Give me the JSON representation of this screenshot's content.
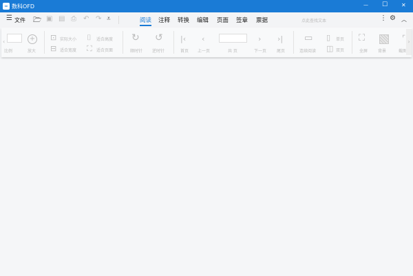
{
  "app": {
    "title": "数科OFD",
    "accent": "#1a7bd6"
  },
  "window_controls": {
    "minimize": "—",
    "maximize": "☐",
    "close": "✕"
  },
  "menu": {
    "file_label": "文件",
    "tabs": [
      "阅读",
      "注释",
      "转换",
      "编辑",
      "页面",
      "签章",
      "票据"
    ],
    "active_tab": "阅读",
    "search_placeholder": "点此查找文本"
  },
  "ribbon": {
    "zoom_label": "比例",
    "zoom_in": "放大",
    "actual_size": "实际大小",
    "fit_width": "适合宽度",
    "fit_height": "适合高度",
    "fit_page": "适合页面",
    "rotate_cw": "顺时针",
    "rotate_ccw": "逆时针",
    "first_page": "首页",
    "prev_page": "上一页",
    "page_total": "共 页",
    "next_page": "下一页",
    "last_page": "尾页",
    "continuous": "连续阅读",
    "single_page": "单页",
    "double_page": "双页",
    "fullscreen": "全屏",
    "background": "背景",
    "screenshot": "截图"
  }
}
